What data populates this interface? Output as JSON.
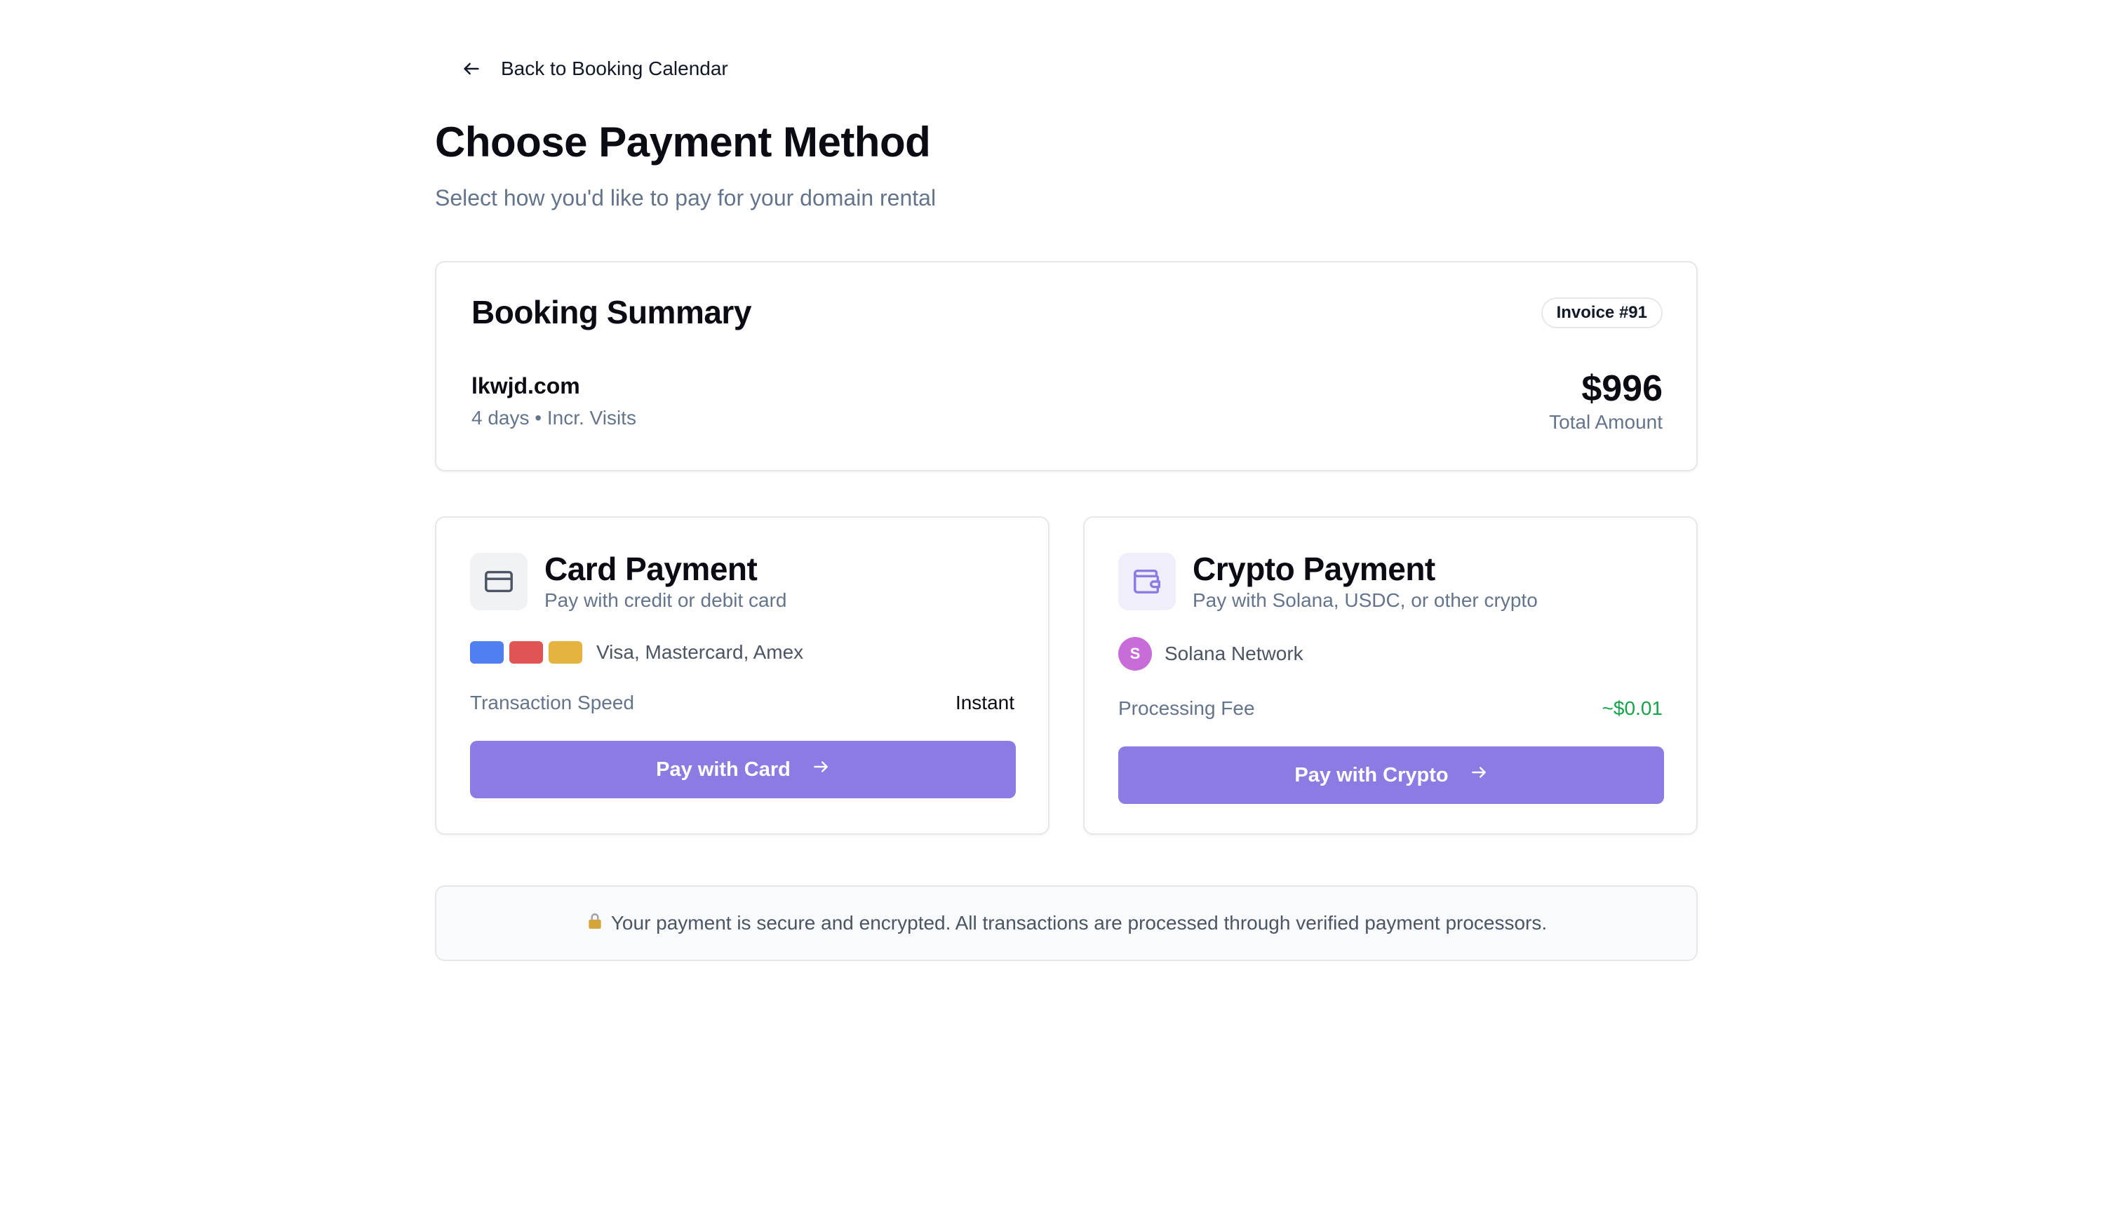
{
  "nav": {
    "back_label": "Back to Booking Calendar"
  },
  "header": {
    "title": "Choose Payment Method",
    "subtitle": "Select how you'd like to pay for your domain rental"
  },
  "summary": {
    "title": "Booking Summary",
    "invoice": "Invoice #91",
    "domain": "lkwjd.com",
    "details": "4 days • Incr. Visits",
    "total_amount": "$996",
    "total_label": "Total Amount"
  },
  "card_payment": {
    "title": "Card Payment",
    "description": "Pay with credit or debit card",
    "brands": "Visa, Mastercard, Amex",
    "brand_chip_colors": [
      "#4f7ff0",
      "#e05454",
      "#e5b440"
    ],
    "row_label": "Transaction Speed",
    "row_value": "Instant",
    "button_label": "Pay with Card",
    "icon": "credit-card-icon"
  },
  "crypto_payment": {
    "title": "Crypto Payment",
    "description": "Pay with Solana, USDC, or other crypto",
    "network_initial": "S",
    "network": "Solana Network",
    "row_label": "Processing Fee",
    "row_value": "~$0.01",
    "button_label": "Pay with Crypto",
    "icon": "wallet-icon"
  },
  "security": {
    "icon": "lock-icon",
    "text": "Your payment is secure and encrypted. All transactions are processed through verified payment processors."
  },
  "colors": {
    "accent": "#8b7be3",
    "fee_green": "#16a34a",
    "muted_text": "#64748b"
  }
}
